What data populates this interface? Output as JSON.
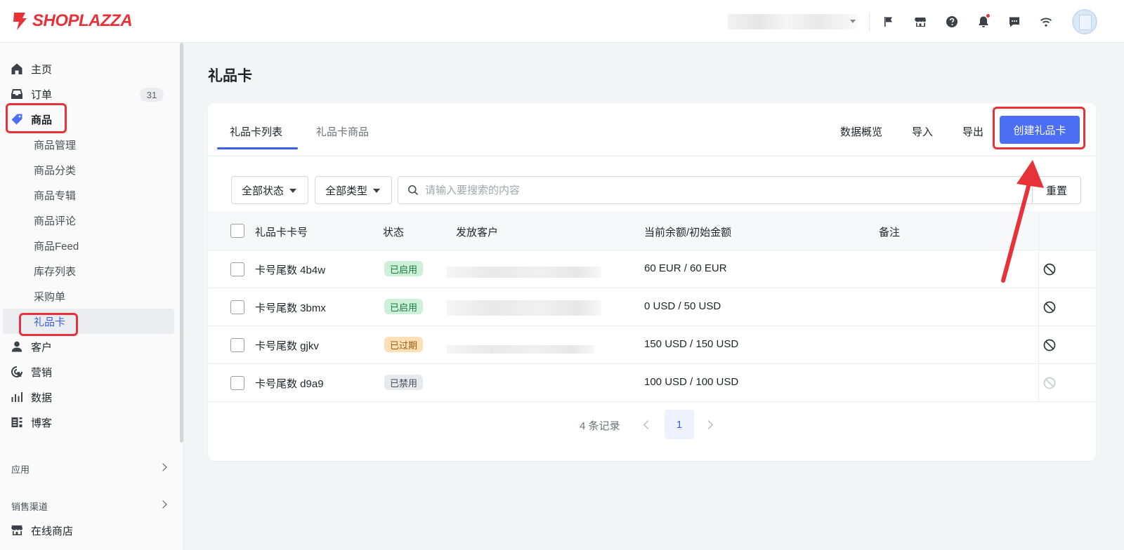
{
  "app": {
    "brand": "SHOPLAZZA"
  },
  "header": {
    "icons": [
      "flag-icon",
      "store-icon",
      "help-icon",
      "bell-icon",
      "chat-icon",
      "wifi-icon"
    ]
  },
  "sidebar": {
    "items": [
      {
        "label": "主页",
        "icon": "home-icon"
      },
      {
        "label": "订单",
        "icon": "inbox-icon",
        "badge": "31"
      },
      {
        "label": "商品",
        "icon": "tag-icon"
      },
      {
        "label": "客户",
        "icon": "user-icon"
      },
      {
        "label": "营销",
        "icon": "target-icon"
      },
      {
        "label": "数据",
        "icon": "bar-chart-icon"
      },
      {
        "label": "博客",
        "icon": "blog-icon"
      }
    ],
    "sub_items": [
      "商品管理",
      "商品分类",
      "商品专辑",
      "商品评论",
      "商品Feed",
      "库存列表",
      "采购单",
      "礼品卡"
    ],
    "sections": {
      "apps": "应用",
      "channels": "销售渠道"
    },
    "online_store": "在线商店"
  },
  "page": {
    "title": "礼品卡",
    "tabs": [
      "礼品卡列表",
      "礼品卡商品"
    ],
    "actions": {
      "overview": "数据概览",
      "import": "导入",
      "export": "导出",
      "create": "创建礼品卡"
    },
    "filters": {
      "status": "全部状态",
      "type": "全部类型",
      "search_placeholder": "请输入要搜索的内容",
      "reset": "重置"
    },
    "table": {
      "columns": [
        "礼品卡卡号",
        "状态",
        "发放客户",
        "当前余额/初始金额",
        "备注"
      ],
      "rows": [
        {
          "card": "卡号尾数 4b4w",
          "status": "已启用",
          "status_color": "#cdf0d9",
          "balance": "60 EUR / 60 EUR"
        },
        {
          "card": "卡号尾数 3bmx",
          "status": "已启用",
          "status_color": "#cdf0d9",
          "balance": "0 USD / 50 USD"
        },
        {
          "card": "卡号尾数 gjkv",
          "status": "已过期",
          "status_color": "#fde0b6",
          "balance": "150 USD / 150 USD"
        },
        {
          "card": "卡号尾数 d9a9",
          "status": "已禁用",
          "status_color": "#e8e9ec",
          "balance": "100 USD / 100 USD"
        }
      ]
    },
    "pagination": {
      "summary": "4 条记录",
      "current_page": "1"
    }
  },
  "colors": {
    "accent": "#4c6ef5",
    "brand": "#e8323a",
    "annotation": "#e8323a"
  }
}
